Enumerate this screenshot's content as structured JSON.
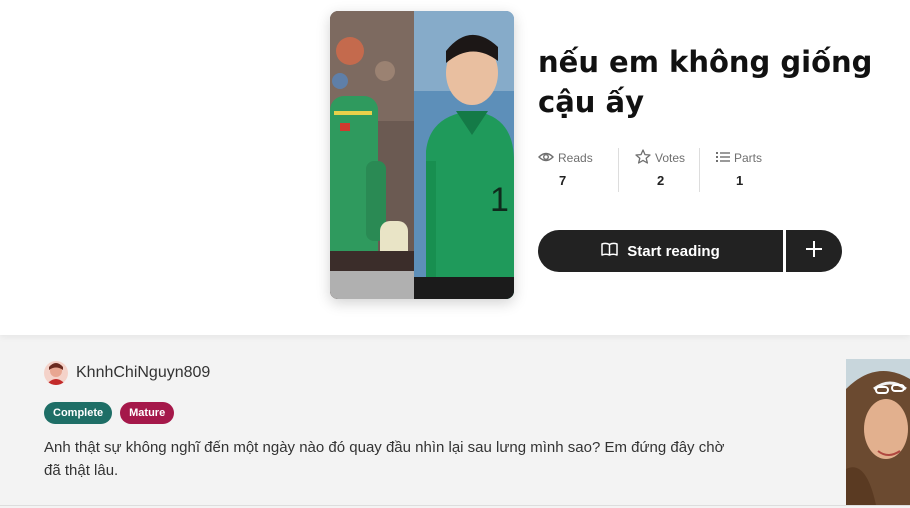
{
  "story": {
    "title": "nếu em không giống cậu ấy",
    "cover_alt": "Story cover"
  },
  "stats": {
    "reads": {
      "label": "Reads",
      "value": "7",
      "icon": "eye-icon"
    },
    "votes": {
      "label": "Votes",
      "value": "2",
      "icon": "star-icon"
    },
    "parts": {
      "label": "Parts",
      "value": "1",
      "icon": "list-icon"
    }
  },
  "actions": {
    "start_reading_label": "Start reading",
    "start_reading_icon": "open-book-icon",
    "add_icon": "plus-icon"
  },
  "author": {
    "name": "KhnhChiNguyn809"
  },
  "tags": {
    "complete": "Complete",
    "mature": "Mature"
  },
  "description": "Anh thật sự không nghĩ đến một ngày nào đó quay đầu nhìn lại sau lưng mình sao? Em đứng đây chờ đã thật lâu.",
  "colors": {
    "button_bg": "#222222",
    "complete_badge": "#1e6e66",
    "mature_badge": "#a5184a",
    "lower_bg": "#f3f3f3"
  }
}
